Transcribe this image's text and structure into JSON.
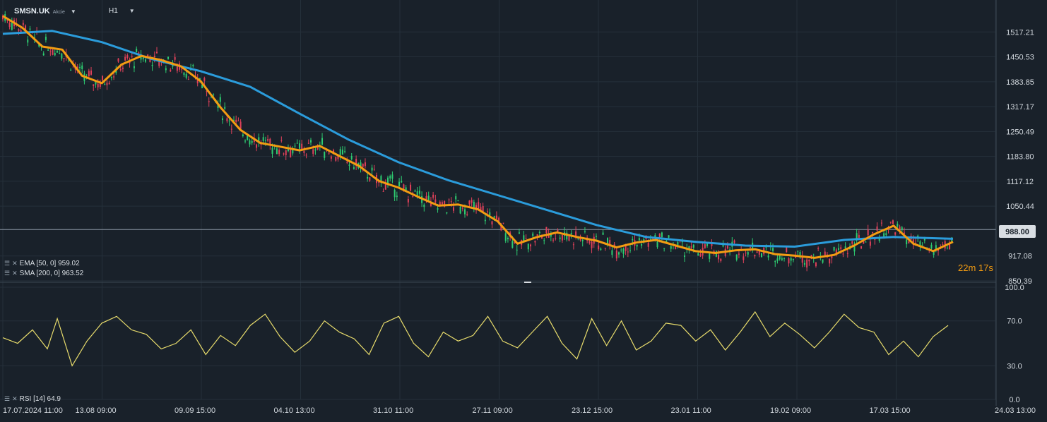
{
  "header": {
    "symbol": "SMSN.UK",
    "instrument_type": "Akcie",
    "timeframe": "H1"
  },
  "indicators": {
    "ema_label": "EMA [50, 0] 959.02",
    "sma_label": "SMA [200, 0] 963.52",
    "rsi_label": "RSI [14] 64.9"
  },
  "current_price_label": "988.00",
  "countdown": "22m 17s",
  "colors": {
    "background": "#19212a",
    "grid": "#25303a",
    "ema": "#f39c12",
    "sma": "#2b9cdb",
    "rsi": "#e8dc6c",
    "candle_up": "#2ecc71",
    "candle_down": "#e0415a",
    "price_line": "#8a96a3"
  },
  "chart_data": [
    {
      "type": "line",
      "title": "",
      "y_ticks": [
        "1517.21",
        "1450.53",
        "1383.85",
        "1317.17",
        "1250.49",
        "1183.80",
        "1117.12",
        "1050.44",
        "988.00",
        "917.08",
        "850.39"
      ],
      "ylim": [
        850.39,
        1565
      ],
      "x_tick_labels": [
        "17.07.2024 11:00",
        "13.08 09:00",
        "09.09 15:00",
        "04.10 13:00",
        "31.10 11:00",
        "27.11 09:00",
        "23.12 15:00",
        "23.01 11:00",
        "19.02 09:00",
        "17.03 15:00",
        "24.03 13:00"
      ],
      "grid": true,
      "series": [
        {
          "name": "EMA [50, 0]",
          "x": [
            0,
            0.02,
            0.04,
            0.06,
            0.08,
            0.1,
            0.12,
            0.14,
            0.16,
            0.18,
            0.2,
            0.22,
            0.24,
            0.26,
            0.28,
            0.3,
            0.32,
            0.34,
            0.36,
            0.38,
            0.4,
            0.42,
            0.44,
            0.46,
            0.48,
            0.5,
            0.52,
            0.54,
            0.56,
            0.58,
            0.6,
            0.62,
            0.64,
            0.66,
            0.68,
            0.7,
            0.72,
            0.74,
            0.76,
            0.78,
            0.8,
            0.82,
            0.84,
            0.86,
            0.88,
            0.9,
            0.92,
            0.94,
            0.96
          ],
          "values": [
            1560,
            1528,
            1478,
            1470,
            1400,
            1380,
            1430,
            1453,
            1442,
            1425,
            1385,
            1315,
            1255,
            1220,
            1210,
            1200,
            1212,
            1185,
            1158,
            1118,
            1100,
            1075,
            1052,
            1055,
            1042,
            1010,
            950,
            968,
            980,
            968,
            958,
            940,
            953,
            960,
            945,
            930,
            925,
            932,
            935,
            922,
            918,
            912,
            920,
            945,
            975,
            998,
            950,
            930,
            955
          ]
        },
        {
          "name": "SMA [200, 0]",
          "x": [
            0,
            0.05,
            0.1,
            0.15,
            0.2,
            0.25,
            0.3,
            0.35,
            0.4,
            0.45,
            0.5,
            0.55,
            0.6,
            0.65,
            0.7,
            0.75,
            0.8,
            0.85,
            0.9,
            0.96
          ],
          "values": [
            1512,
            1520,
            1490,
            1445,
            1412,
            1370,
            1298,
            1228,
            1168,
            1120,
            1080,
            1040,
            1000,
            968,
            955,
            945,
            942,
            960,
            968,
            963
          ]
        },
        {
          "name": "RSI [14]",
          "x": [
            0,
            0.015,
            0.03,
            0.045,
            0.055,
            0.07,
            0.085,
            0.1,
            0.115,
            0.13,
            0.145,
            0.16,
            0.175,
            0.19,
            0.205,
            0.22,
            0.235,
            0.25,
            0.265,
            0.28,
            0.295,
            0.31,
            0.325,
            0.34,
            0.355,
            0.37,
            0.385,
            0.4,
            0.415,
            0.43,
            0.445,
            0.46,
            0.475,
            0.49,
            0.505,
            0.52,
            0.535,
            0.55,
            0.565,
            0.58,
            0.595,
            0.61,
            0.625,
            0.64,
            0.655,
            0.67,
            0.685,
            0.7,
            0.715,
            0.73,
            0.745,
            0.76,
            0.775,
            0.79,
            0.805,
            0.82,
            0.835,
            0.85,
            0.865,
            0.88,
            0.895,
            0.91,
            0.925,
            0.94,
            0.955
          ],
          "values": [
            55,
            50,
            62,
            45,
            72,
            30,
            52,
            68,
            74,
            62,
            58,
            45,
            50,
            62,
            40,
            57,
            48,
            66,
            76,
            56,
            42,
            52,
            70,
            60,
            54,
            40,
            68,
            74,
            50,
            38,
            60,
            52,
            57,
            74,
            52,
            46,
            60,
            74,
            50,
            36,
            72,
            48,
            70,
            44,
            52,
            68,
            66,
            52,
            62,
            44,
            60,
            78,
            56,
            68,
            58,
            46,
            60,
            76,
            64,
            60,
            40,
            52,
            38,
            56,
            66
          ]
        }
      ]
    }
  ]
}
